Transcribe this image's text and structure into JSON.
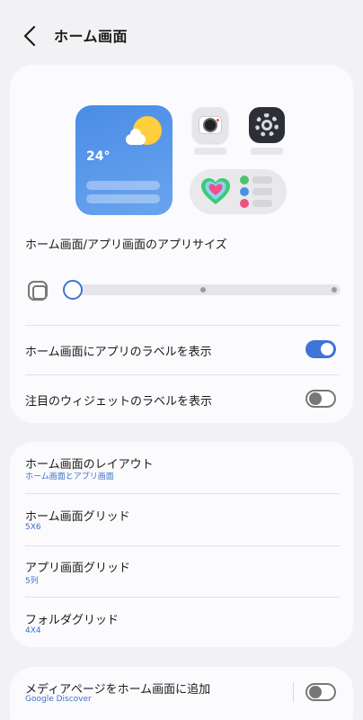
{
  "header": {
    "title": "ホーム画面",
    "back_icon": "chevron-left-icon"
  },
  "preview": {
    "weather_temp": "24°",
    "icons": [
      "camera-app-icon",
      "settings-app-icon",
      "health-widget-icon"
    ]
  },
  "app_size": {
    "label": "ホーム画面/アプリ画面のアプリサイズ",
    "slider_value": 0,
    "slider_steps": 3
  },
  "toggles": {
    "show_app_labels": {
      "label": "ホーム画面にアプリのラベルを表示",
      "on": true
    },
    "show_widget_labels": {
      "label": "注目のウィジェットのラベルを表示",
      "on": false
    }
  },
  "layout_section": {
    "items": [
      {
        "label": "ホーム画面のレイアウト",
        "value": "ホーム画面とアプリ画面"
      },
      {
        "label": "ホーム画面グリッド",
        "value": "5X6"
      },
      {
        "label": "アプリ画面グリッド",
        "value": "5列"
      },
      {
        "label": "フォルダグリッド",
        "value": "4X4"
      }
    ]
  },
  "media_page": {
    "label": "メディアページをホーム画面に追加",
    "value": "Google Discover",
    "on": false
  },
  "colors": {
    "accent": "#3f74d8",
    "subtext": "#3e6fc7",
    "background": "#f2f2f4"
  }
}
